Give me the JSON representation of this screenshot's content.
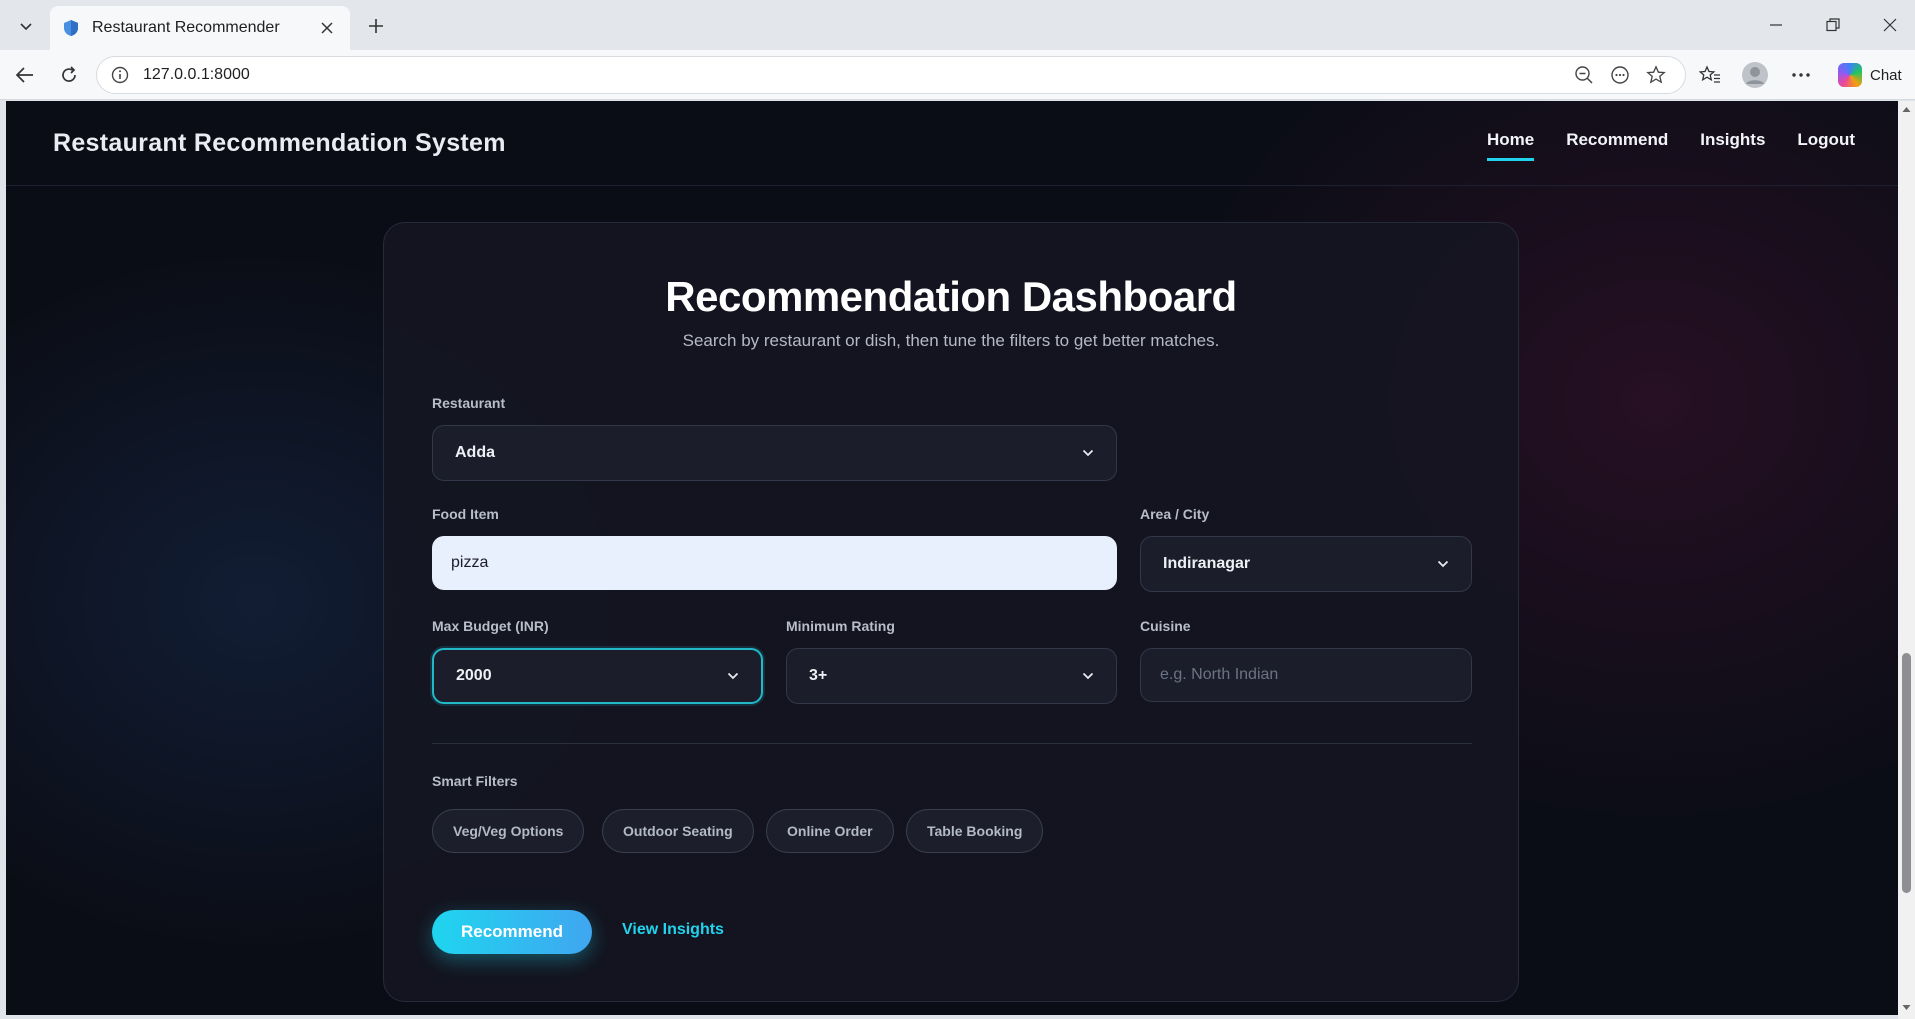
{
  "browser": {
    "tab_title": "Restaurant Recommender",
    "url": "127.0.0.1:8000",
    "chat_label": "Chat"
  },
  "site": {
    "title": "Restaurant Recommendation System",
    "nav": [
      {
        "label": "Home",
        "active": true
      },
      {
        "label": "Recommend"
      },
      {
        "label": "Insights"
      },
      {
        "label": "Logout"
      }
    ]
  },
  "dashboard": {
    "title": "Recommendation Dashboard",
    "subtitle": "Search by restaurant or dish, then tune the filters to get better matches.",
    "restaurant": {
      "label": "Restaurant",
      "value": "Adda"
    },
    "food_item": {
      "label": "Food Item",
      "value": "pizza"
    },
    "area": {
      "label": "Area / City",
      "value": "Indiranagar"
    },
    "budget": {
      "label": "Max Budget (INR)",
      "value": "2000"
    },
    "rating": {
      "label": "Minimum Rating",
      "value": "3+"
    },
    "cuisine": {
      "label": "Cuisine",
      "placeholder": "e.g. North Indian"
    },
    "smart_filters": {
      "label": "Smart Filters",
      "chips": [
        "Veg/Veg Options",
        "Outdoor Seating",
        "Online Order",
        "Table Booking"
      ]
    },
    "recommend_button": "Recommend",
    "insights_link": "View Insights"
  },
  "colors": {
    "accent": "#22d3ee",
    "background": "#0b0d16"
  }
}
